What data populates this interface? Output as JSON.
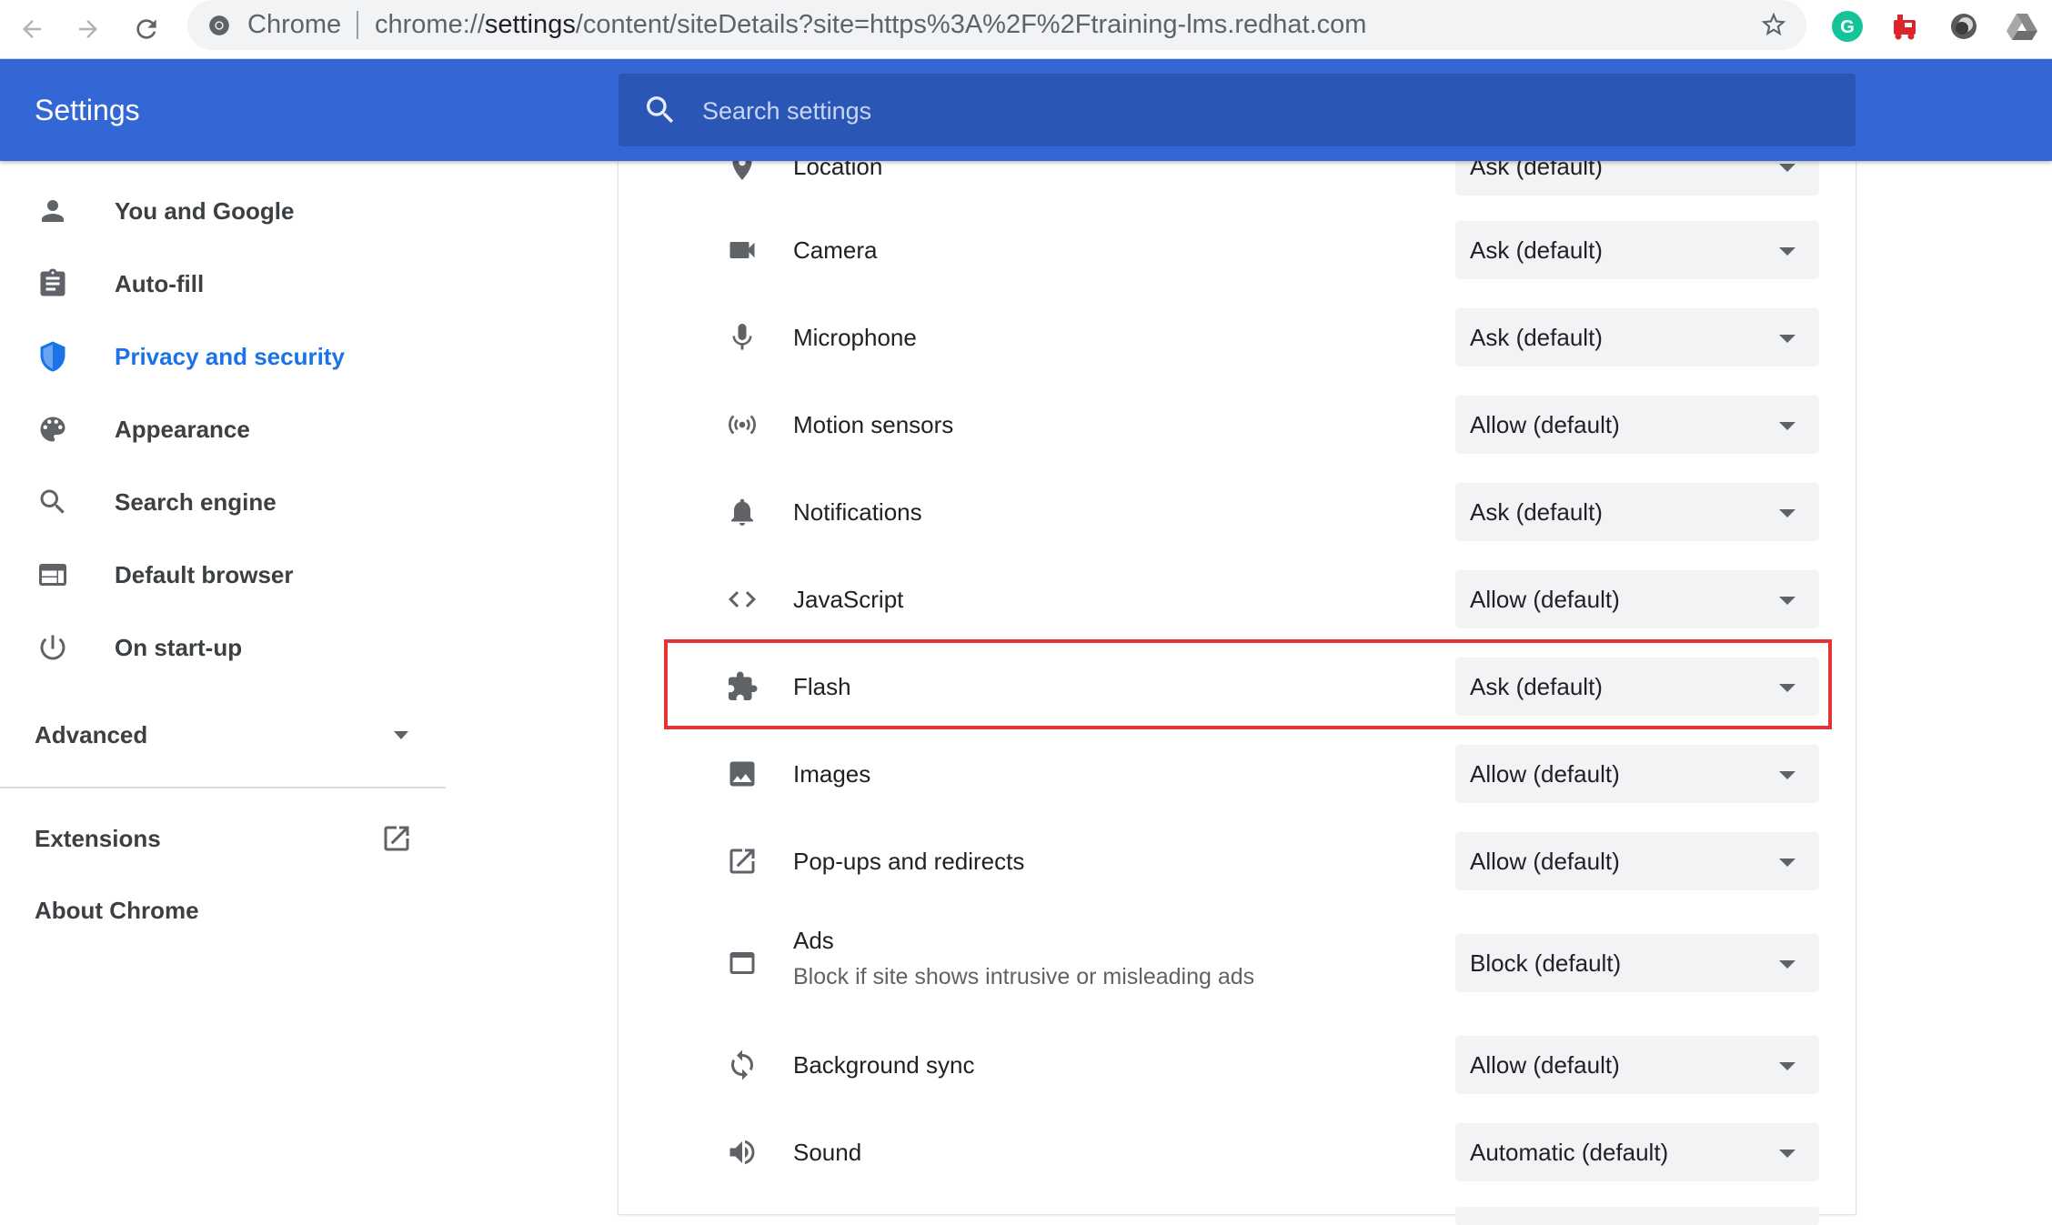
{
  "browser": {
    "site_label": "Chrome",
    "url_prefix": "chrome://",
    "url_host": "settings",
    "url_path": "/content/siteDetails?site=https%3A%2F%2Ftraining-lms.redhat.com",
    "extension_icons": [
      "grammarly-icon",
      "red-train-extension-icon",
      "dark-circle-extension-icon",
      "google-drive-icon"
    ]
  },
  "header": {
    "title": "Settings",
    "search_placeholder": "Search settings"
  },
  "sidebar": {
    "items": [
      {
        "label": "You and Google",
        "icon": "person-icon"
      },
      {
        "label": "Auto-fill",
        "icon": "clipboard-icon"
      },
      {
        "label": "Privacy and security",
        "icon": "shield-icon",
        "active": true
      },
      {
        "label": "Appearance",
        "icon": "palette-icon"
      },
      {
        "label": "Search engine",
        "icon": "search-icon"
      },
      {
        "label": "Default browser",
        "icon": "browser-window-icon"
      },
      {
        "label": "On start-up",
        "icon": "power-icon"
      }
    ],
    "advanced_label": "Advanced",
    "extensions_label": "Extensions",
    "about_label": "About Chrome"
  },
  "permissions": [
    {
      "label": "Location",
      "value": "Ask (default)",
      "icon": "location-pin-icon"
    },
    {
      "label": "Camera",
      "value": "Ask (default)",
      "icon": "camera-icon"
    },
    {
      "label": "Microphone",
      "value": "Ask (default)",
      "icon": "microphone-icon"
    },
    {
      "label": "Motion sensors",
      "value": "Allow (default)",
      "icon": "motion-sensors-icon"
    },
    {
      "label": "Notifications",
      "value": "Ask (default)",
      "icon": "bell-icon"
    },
    {
      "label": "JavaScript",
      "value": "Allow (default)",
      "icon": "code-icon"
    },
    {
      "label": "Flash",
      "value": "Ask (default)",
      "icon": "puzzle-piece-icon",
      "highlighted": true
    },
    {
      "label": "Images",
      "value": "Allow (default)",
      "icon": "image-icon"
    },
    {
      "label": "Pop-ups and redirects",
      "value": "Allow (default)",
      "icon": "open-in-new-icon"
    },
    {
      "label": "Ads",
      "sublabel": "Block if site shows intrusive or misleading ads",
      "value": "Block (default)",
      "icon": "ads-window-icon"
    },
    {
      "label": "Background sync",
      "value": "Allow (default)",
      "icon": "sync-icon"
    },
    {
      "label": "Sound",
      "value": "Automatic (default)",
      "icon": "speaker-icon"
    }
  ],
  "colors": {
    "header_blue": "#3367d6",
    "search_blue": "#2a56b6",
    "active_blue": "#1a73e8",
    "highlight_red": "#e33535"
  }
}
